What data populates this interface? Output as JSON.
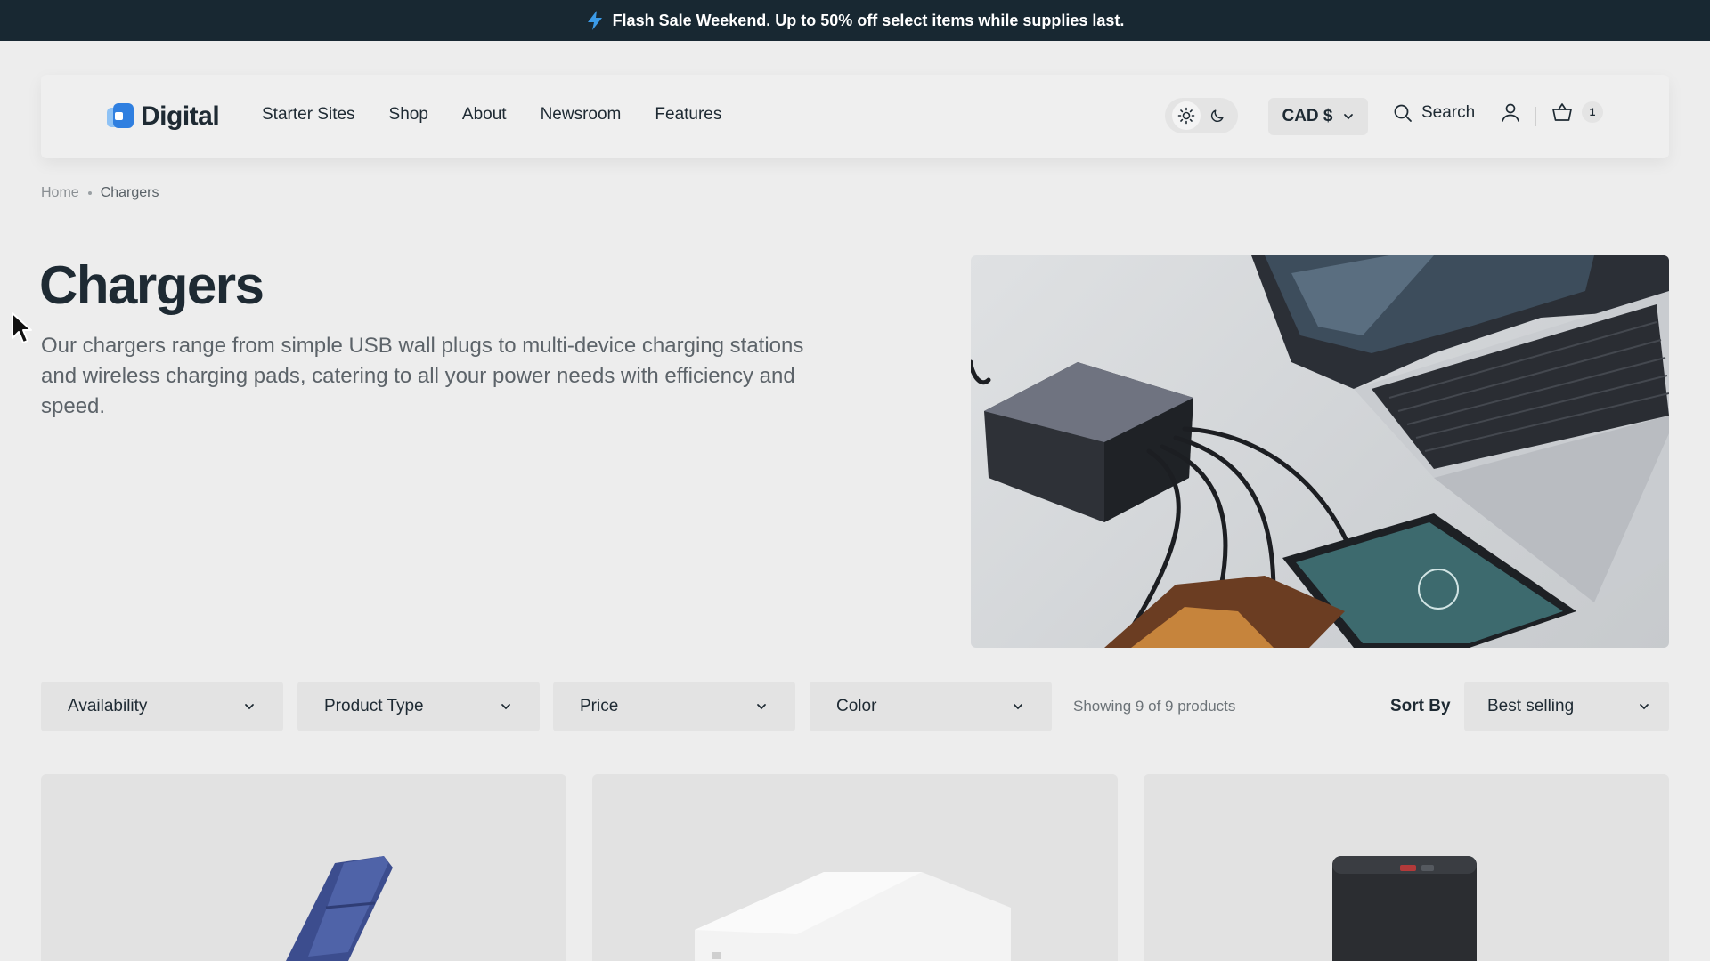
{
  "announcement": {
    "text": "Flash Sale Weekend. Up to 50% off select items while supplies last."
  },
  "brand": {
    "name": "Digital",
    "accent": "#3b82e0"
  },
  "nav": {
    "items": [
      "Starter Sites",
      "Shop",
      "About",
      "Newsroom",
      "Features"
    ]
  },
  "header": {
    "currency": "CAD $",
    "search_label": "Search",
    "cart_count": "1"
  },
  "breadcrumb": {
    "home": "Home",
    "current": "Chargers"
  },
  "page": {
    "title": "Chargers",
    "description": "Our chargers range from simple USB wall plugs to multi-device charging stations and wireless charging pads, catering to all your power needs with efficiency and speed."
  },
  "filters": {
    "items": [
      "Availability",
      "Product Type",
      "Price",
      "Color"
    ],
    "showing": "Showing 9 of 9 products",
    "sort_label": "Sort By",
    "sort_value": "Best selling"
  }
}
